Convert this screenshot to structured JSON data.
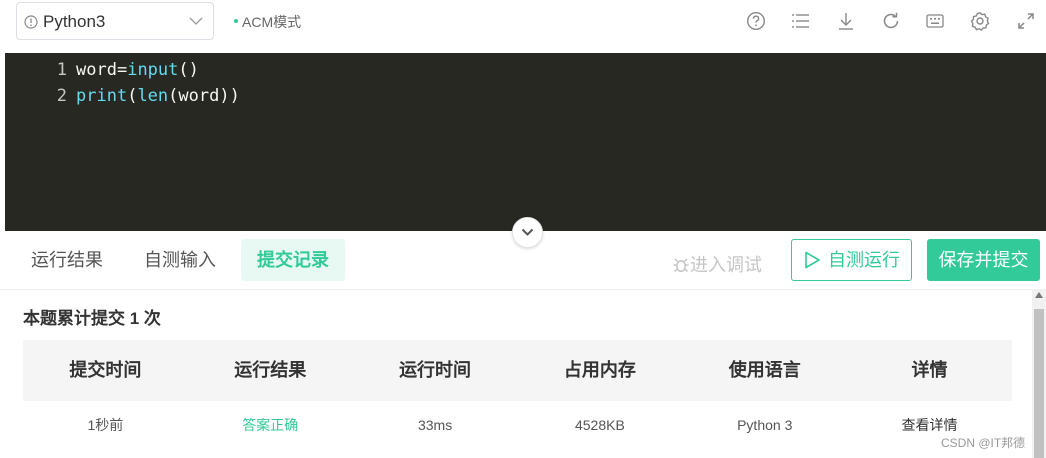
{
  "toolbar": {
    "language": "Python3",
    "mode": "ACM模式",
    "accent": "#32ca99"
  },
  "editor": {
    "background": "#272822",
    "lines": [
      {
        "num": "1",
        "tokens": [
          {
            "t": "word",
            "k": "plain"
          },
          {
            "t": "=",
            "k": "op"
          },
          {
            "t": "input",
            "k": "fn"
          },
          {
            "t": "()",
            "k": "plain"
          }
        ]
      },
      {
        "num": "2",
        "tokens": [
          {
            "t": "print",
            "k": "fn"
          },
          {
            "t": "(",
            "k": "plain"
          },
          {
            "t": "len",
            "k": "fn"
          },
          {
            "t": "(word))",
            "k": "plain"
          }
        ]
      }
    ]
  },
  "panel": {
    "tabs": [
      {
        "label": "运行结果",
        "active": false
      },
      {
        "label": "自测输入",
        "active": false
      },
      {
        "label": "提交记录",
        "active": true
      }
    ],
    "debug_label": "进入调试",
    "run_label": "自测运行",
    "submit_label": "保存并提交"
  },
  "records": {
    "summary": "本题累计提交 1 次",
    "columns": [
      "提交时间",
      "运行结果",
      "运行时间",
      "占用内存",
      "使用语言",
      "详情"
    ],
    "rows": [
      [
        "1秒前",
        "答案正确",
        "33ms",
        "4528KB",
        "Python 3",
        "查看详情"
      ]
    ]
  },
  "watermark": "CSDN @IT邦德"
}
